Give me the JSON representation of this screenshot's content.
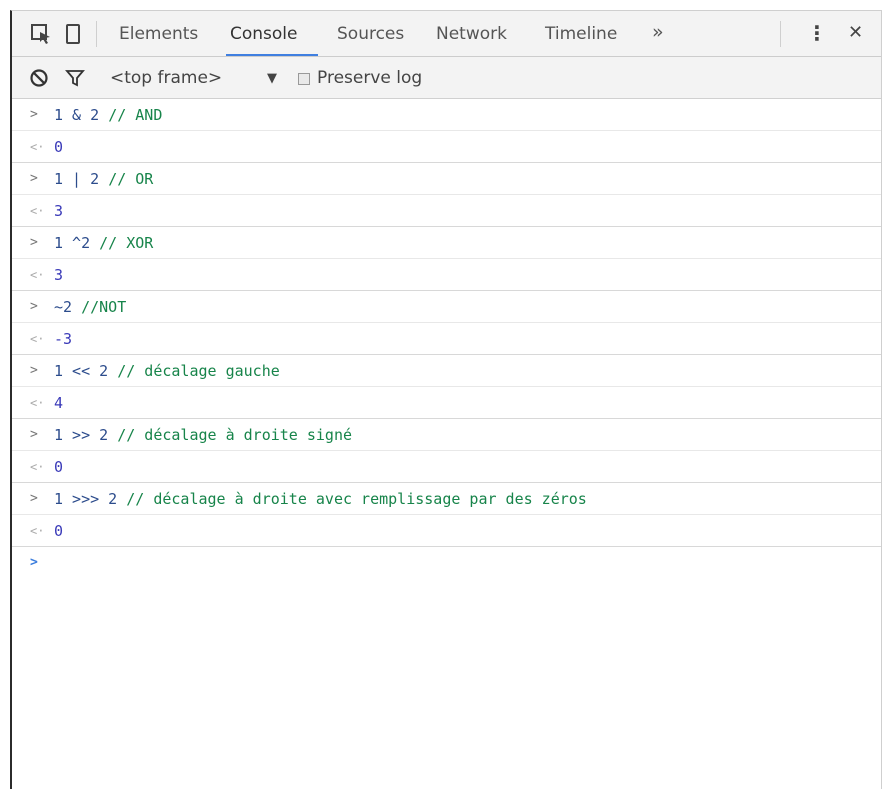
{
  "toolbar": {
    "icons": [
      "inspect-icon",
      "device-icon"
    ],
    "tabs": [
      {
        "label": "Elements"
      },
      {
        "label": "Console"
      },
      {
        "label": "Sources"
      },
      {
        "label": "Network"
      },
      {
        "label": "Timeline"
      }
    ],
    "active_tab": "Console",
    "more_tabs_glyph": "»",
    "menu_glyph": "⋮",
    "close_glyph": "✕"
  },
  "filterbar": {
    "context_select": "<top frame>",
    "dropdown_glyph": "▼",
    "preserve_log_label": "Preserve log"
  },
  "console": {
    "prompt_glyph": ">",
    "return_glyph": "<·",
    "entries": [
      {
        "code": "1 & 2 ",
        "comment": "// AND",
        "result": "0"
      },
      {
        "code": "1 | 2 ",
        "comment": "// OR",
        "result": "3"
      },
      {
        "code": "1 ^2 ",
        "comment": "// XOR",
        "result": "3"
      },
      {
        "code": "~2 ",
        "comment": "//NOT",
        "result": "-3"
      },
      {
        "code": "1 << 2 ",
        "comment": "// décalage gauche",
        "result": "4"
      },
      {
        "code": "1 >> 2 ",
        "comment": "// décalage à droite signé",
        "result": "0"
      },
      {
        "code": "1 >>> 2 ",
        "comment": "// décalage à droite avec remplissage par des zéros",
        "result": "0"
      }
    ]
  }
}
